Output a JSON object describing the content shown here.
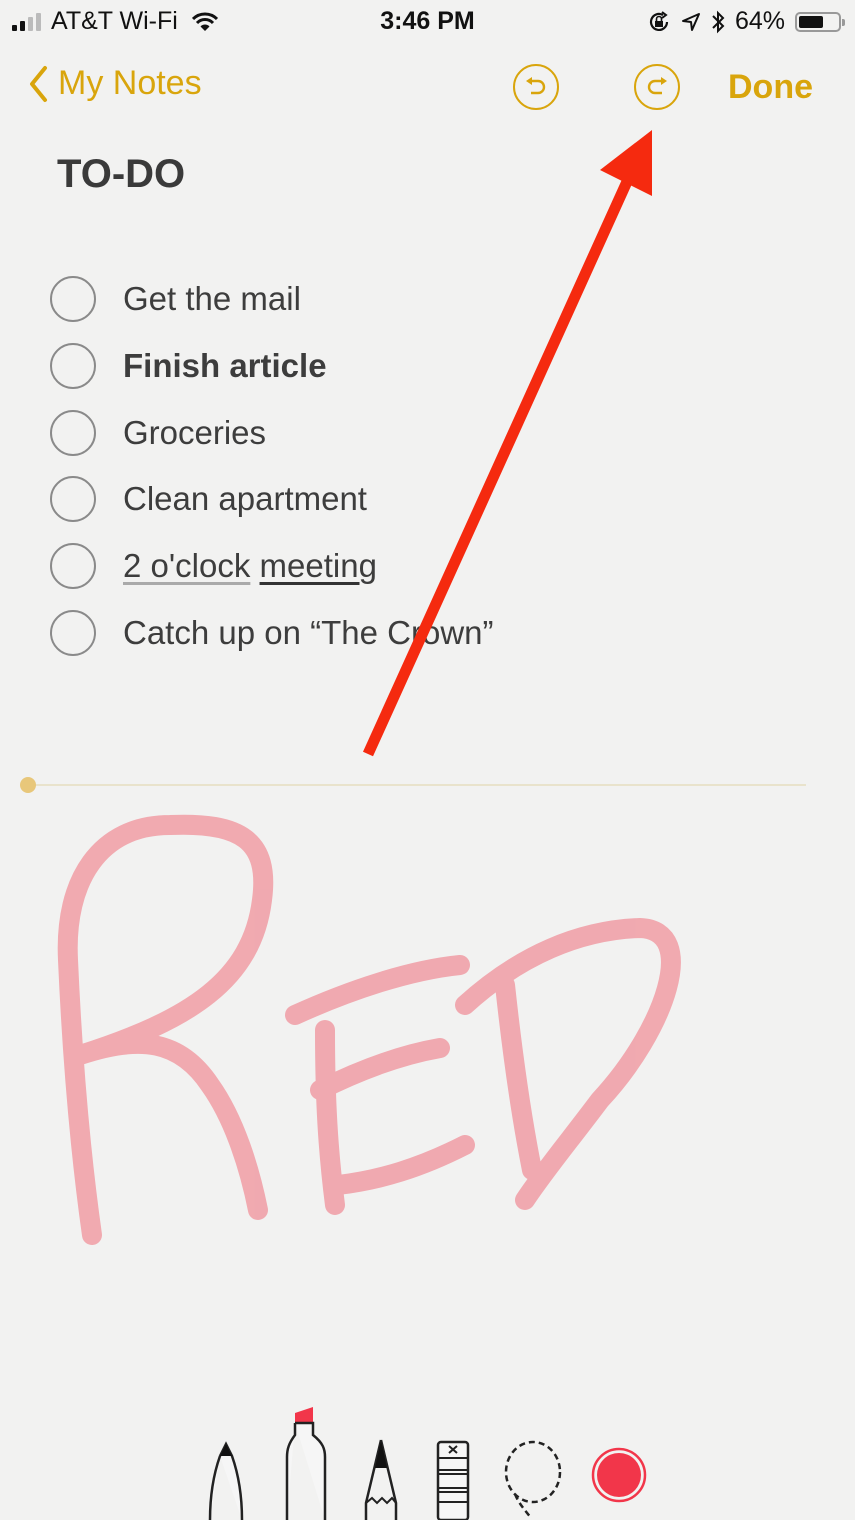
{
  "status_bar": {
    "carrier": "AT&T Wi-Fi",
    "time": "3:46 PM",
    "battery_percent_label": "64%",
    "battery_level": 0.64,
    "icons": [
      "signal-icon",
      "wifi-icon",
      "rotation-lock-icon",
      "location-icon",
      "bluetooth-icon",
      "battery-icon"
    ]
  },
  "nav": {
    "back_label": "My Notes",
    "undo_icon": "undo-icon",
    "redo_icon": "redo-icon",
    "done_label": "Done",
    "accent_color": "#d9a50c"
  },
  "note": {
    "title": "TO-DO",
    "items": [
      {
        "text": "Get the mail",
        "checked": false,
        "style": "normal"
      },
      {
        "text": "Finish article",
        "checked": false,
        "style": "bold"
      },
      {
        "text": "Groceries",
        "checked": false,
        "style": "normal"
      },
      {
        "text": "Clean apartment",
        "checked": false,
        "style": "normal"
      },
      {
        "text_part1": "2 o'clock",
        "text_sep": " ",
        "text_part2": "meeting",
        "checked": false,
        "style": "underlined"
      },
      {
        "text": "Catch up on “The Crown”",
        "checked": false,
        "style": "normal"
      }
    ]
  },
  "drawing": {
    "handwritten_text": "RED",
    "ink_color": "#f07a86"
  },
  "annotation": {
    "arrow_color": "#f52a0f",
    "points_to": "redo-button"
  },
  "toolbar": {
    "tools": [
      "pen",
      "marker",
      "pencil",
      "eraser",
      "lasso",
      "color"
    ],
    "selected_tool": "marker",
    "selected_color": "#f2364a"
  }
}
